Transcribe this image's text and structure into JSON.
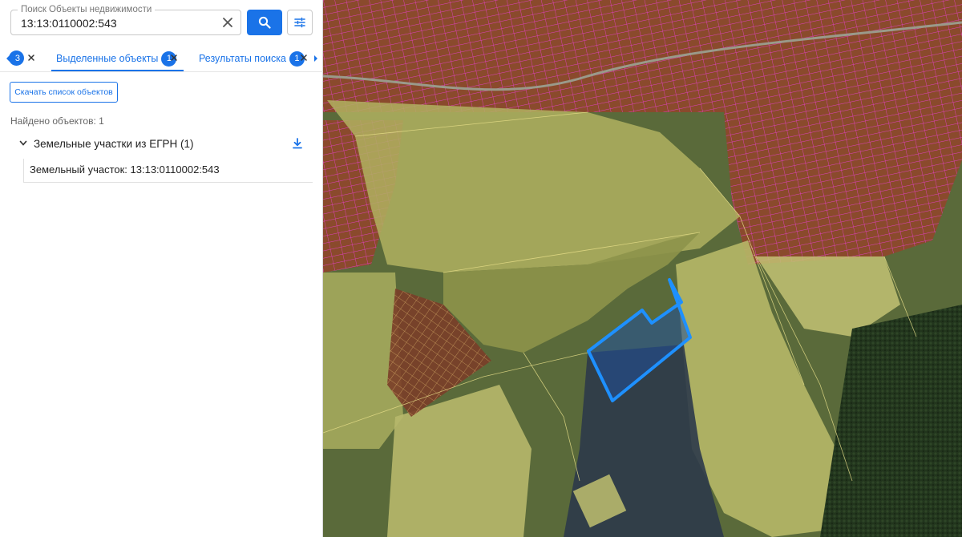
{
  "search": {
    "legend": "Поиск Объекты недвижимости",
    "value": "13:13:0110002:543"
  },
  "tabs": {
    "partial_badge": "3",
    "selected_label": "Выделенные объекты",
    "selected_count": "1",
    "results_label": "Результаты поиска",
    "results_count": "1"
  },
  "download_list_label": "Скачать список объектов",
  "found_label": "Найдено объектов: 1",
  "group": {
    "title": "Земельные участки из ЕГРН (1)",
    "items": [
      {
        "label": "Земельный участок: 13:13:0110002:543"
      }
    ]
  },
  "colors": {
    "accent": "#1a73e8",
    "highlight_parcel": "#1e90ff",
    "parcel_overlay": "#d9d96a",
    "cadastral_lines": "#e040c0"
  },
  "icons": {
    "clear": "close-icon",
    "search": "search-icon",
    "filter": "tune-icon",
    "download": "download-icon",
    "chevron": "chevron-down-icon"
  }
}
